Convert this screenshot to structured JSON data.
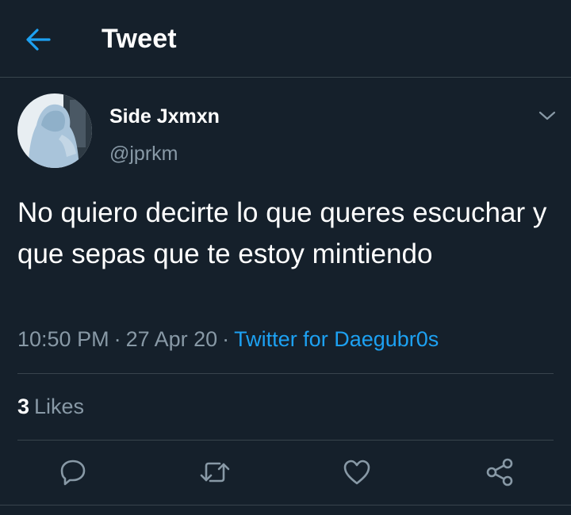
{
  "header": {
    "title": "Tweet",
    "back_icon": "arrow-left-icon"
  },
  "author": {
    "display_name": "Side Jxmxn",
    "handle": "@jprkm"
  },
  "tweet": {
    "text": "No quiero decirte lo que queres escuchar y que sepas que te estoy mintiendo",
    "time": "10:50 PM",
    "date": "27 Apr 20",
    "source": "Twitter for Daegubr0s",
    "separator": "·"
  },
  "stats": {
    "likes_count": "3",
    "likes_label": "Likes"
  },
  "actions": [
    "reply-icon",
    "retweet-icon",
    "like-icon",
    "share-icon"
  ],
  "colors": {
    "background": "#15202b",
    "accent": "#1da1f2",
    "muted": "#8899a6",
    "divider": "#38444d"
  }
}
